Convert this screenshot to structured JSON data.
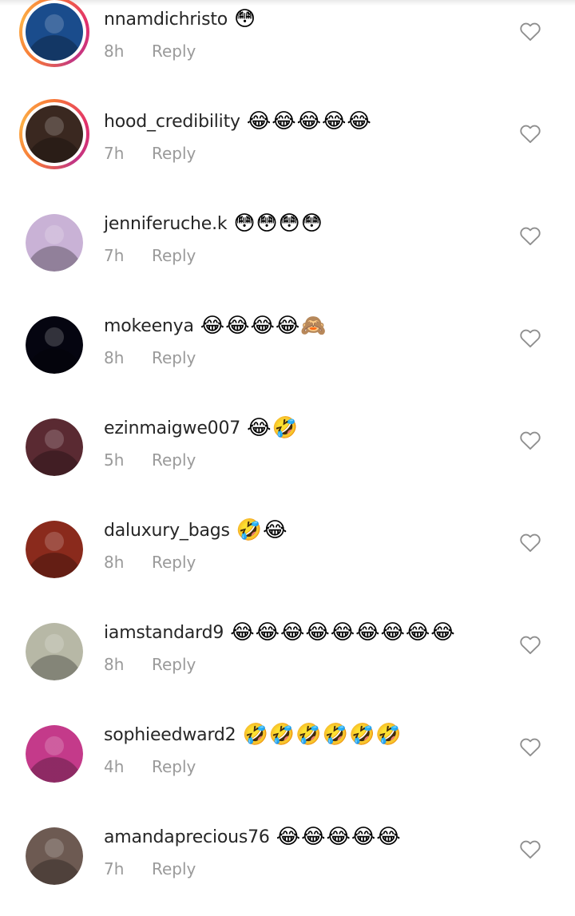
{
  "comments": [
    {
      "username": "nnamdichristo",
      "emojis": "😳",
      "time": "8h",
      "reply": "Reply",
      "story": true,
      "avatar_color": "#1a4c8c"
    },
    {
      "username": "hood_credibility",
      "emojis": "😂😂😂😂😂",
      "time": "7h",
      "reply": "Reply",
      "story": true,
      "avatar_color": "#3a2820"
    },
    {
      "username": "jenniferuche.k",
      "emojis": "😳😳😳😳",
      "time": "7h",
      "reply": "Reply",
      "story": false,
      "avatar_color": "#c9b2d6"
    },
    {
      "username": "mokeenya",
      "emojis": "😂😂😂😂🙈",
      "time": "8h",
      "reply": "Reply",
      "story": false,
      "avatar_color": "#050510"
    },
    {
      "username": "ezinmaigwe007",
      "emojis": "😂🤣",
      "time": "5h",
      "reply": "Reply",
      "story": false,
      "avatar_color": "#5a2a32"
    },
    {
      "username": "daluxury_bags",
      "emojis": "🤣😂",
      "time": "8h",
      "reply": "Reply",
      "story": false,
      "avatar_color": "#8a2a1c"
    },
    {
      "username": "iamstandard9",
      "emojis": "😂😂😂😂😂😂😂😂😂",
      "time": "8h",
      "reply": "Reply",
      "story": false,
      "avatar_color": "#b7b8a6"
    },
    {
      "username": "sophieedward2",
      "emojis": "🤣🤣🤣🤣🤣🤣",
      "time": "4h",
      "reply": "Reply",
      "story": false,
      "avatar_color": "#c43a8a"
    },
    {
      "username": "amandaprecious76",
      "emojis": "😂😂😂😂😂",
      "time": "7h",
      "reply": "Reply",
      "story": false,
      "avatar_color": "#6d5a52"
    }
  ],
  "icons": {
    "like": "heart-outline-icon"
  },
  "colors": {
    "username": "#262626",
    "meta": "#9a9a9a",
    "story_ring": "#e1306c"
  }
}
